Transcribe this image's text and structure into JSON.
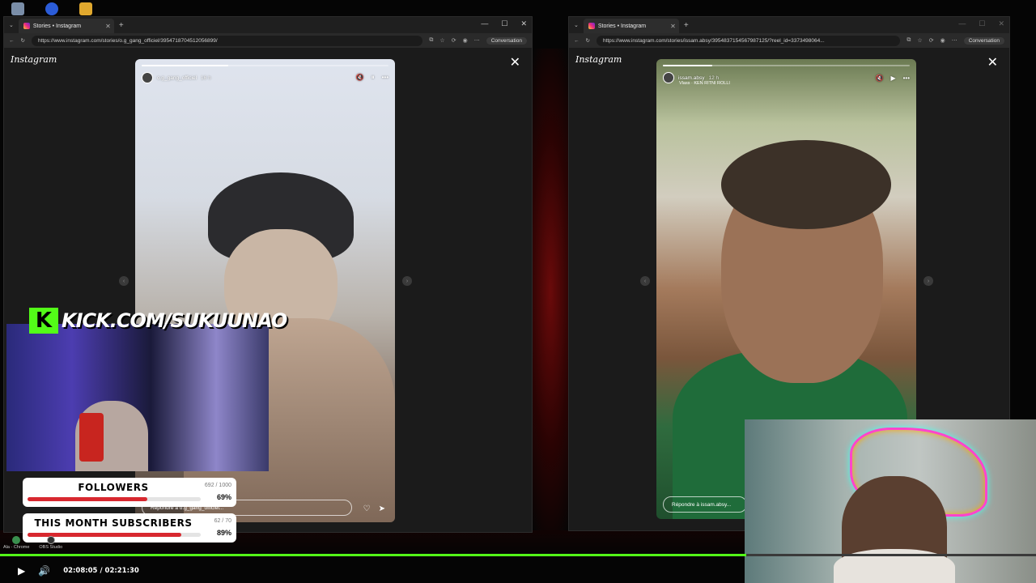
{
  "left_window": {
    "tab_title": "Stories • Instagram",
    "url": "https://www.instagram.com/stories/o.g_gang_officiel/3954718704512056899/",
    "conversation_label": "Conversation",
    "logo": "Instagram",
    "story": {
      "username": "o.g_gang_officiel",
      "time": "16 h",
      "reply_placeholder": "Répondre à o.g_gang_officiel...",
      "progress": 0.35
    }
  },
  "right_window": {
    "tab_title": "Stories • Instagram",
    "url": "https://www.instagram.com/stories/issam.absy/3954837154567987125/?reel_id=3373498064...",
    "conversation_label": "Conversation",
    "logo": "Instagram",
    "story": {
      "username": "issam.absy",
      "time": "12 h",
      "audio": "Vlass · KEN RITNI ROLLI",
      "reply_placeholder": "Répondre à issam.absy...",
      "progress": 0.2
    }
  },
  "overlay": {
    "kick_url": "KICK.COM/SUKUUNAO",
    "followers": {
      "label": "FOLLOWERS",
      "count": "692 / 1000",
      "percent_text": "69%",
      "fraction": 0.69
    },
    "subscribers": {
      "label": "THIS MONTH SUBSCRIBERS",
      "count": "62 / 70",
      "percent_text": "89%",
      "fraction": 0.89
    }
  },
  "taskbar": {
    "apps": [
      "Ala - Chrome",
      "OBS Studio"
    ]
  },
  "player": {
    "current_time": "02:08:05",
    "separator": "/",
    "duration": "02:21:30",
    "played_fraction": 0.72
  },
  "colors": {
    "kick_green": "#53fc18",
    "progress_red": "#d8282f"
  },
  "icons": {
    "close": "✕",
    "new_tab": "+",
    "mute": "🔇",
    "pause": "⏸",
    "more": "•••",
    "heart": "♡",
    "send": "➤",
    "play": "▶",
    "volume": "🔊",
    "nav_left": "‹",
    "nav_right": "›"
  }
}
